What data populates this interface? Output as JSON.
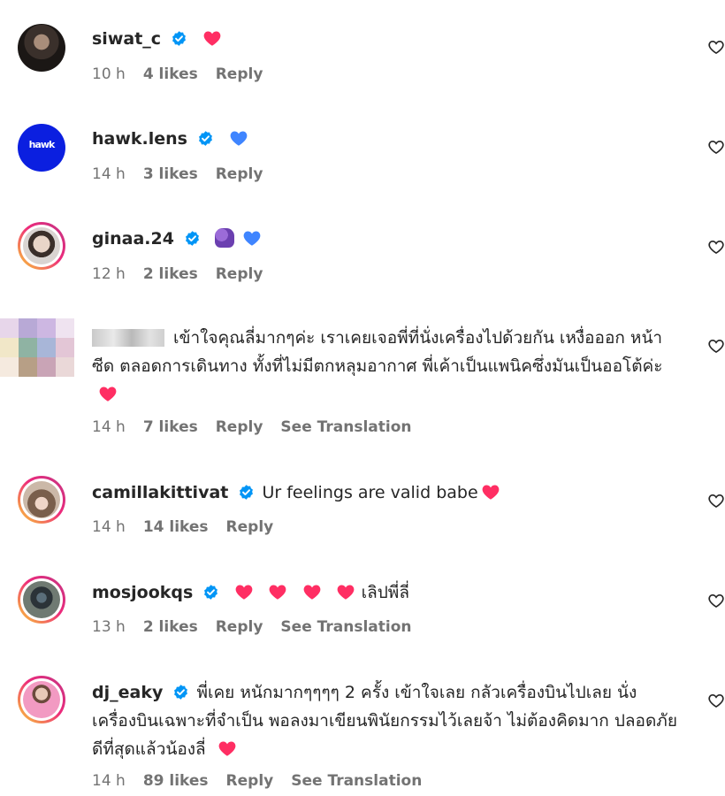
{
  "colors": {
    "heart_red": "#ff2e63",
    "heart_blue": "#3f85ff",
    "verified": "#0095f6",
    "meta_text": "#737373"
  },
  "comments": [
    {
      "username": "siwat_c",
      "verified": true,
      "text": "",
      "emojis": [
        "red-heart"
      ],
      "time": "10 h",
      "likes": "4 likes",
      "reply": "Reply",
      "translation": ""
    },
    {
      "username": "hawk.lens",
      "verified": true,
      "text": "",
      "emojis": [
        "blue-heart"
      ],
      "time": "14 h",
      "likes": "3 likes",
      "reply": "Reply",
      "translation": "",
      "avatar_text": "hawk"
    },
    {
      "username": "ginaa.24",
      "verified": true,
      "text": "",
      "emojis": [
        "couple-kiss",
        "blue-heart"
      ],
      "time": "12 h",
      "likes": "2 likes",
      "reply": "Reply",
      "translation": ""
    },
    {
      "username": "",
      "verified": false,
      "text": "เข้าใจคุณลี่มากๆค่ะ เราเคยเจอพี่ที่นั่งเครื่องไปด้วยกัน เหงื่อออก หน้าซีด ตลอดการเดินทาง ทั้งที่ไม่มีตกหลุมอากาศ พี่เค้าเป็นแพนิคซึ่งมันเป็นออโต้ค่ะ",
      "emojis": [
        "red-heart"
      ],
      "time": "14 h",
      "likes": "7 likes",
      "reply": "Reply",
      "translation": "See Translation"
    },
    {
      "username": "camillakittivat",
      "verified": true,
      "text": "Ur feelings are valid babe",
      "emojis": [
        "red-heart"
      ],
      "time": "14 h",
      "likes": "14 likes",
      "reply": "Reply",
      "translation": ""
    },
    {
      "username": "mosjookqs",
      "verified": true,
      "text": "เลิปพี่ลี่",
      "emojis": [
        "red-heart",
        "red-heart",
        "red-heart",
        "red-heart"
      ],
      "time": "13 h",
      "likes": "2 likes",
      "reply": "Reply",
      "translation": "See Translation"
    },
    {
      "username": "dj_eaky",
      "verified": true,
      "text": "พี่เคย หนักมากๆๆๆๆ 2 ครั้ง เข้าใจเลย กลัวเครื่องบินไปเลย นั่งเครื่องบินเฉพาะที่จำเป็น พอลงมาเขียนพินัยกรรมไว้เลยจ้า ไม่ต้องคิดมาก ปลอดภัยดีที่สุดแล้วน้องลี่",
      "emojis": [
        "red-heart"
      ],
      "time": "14 h",
      "likes": "89 likes",
      "reply": "Reply",
      "translation": "See Translation"
    }
  ]
}
